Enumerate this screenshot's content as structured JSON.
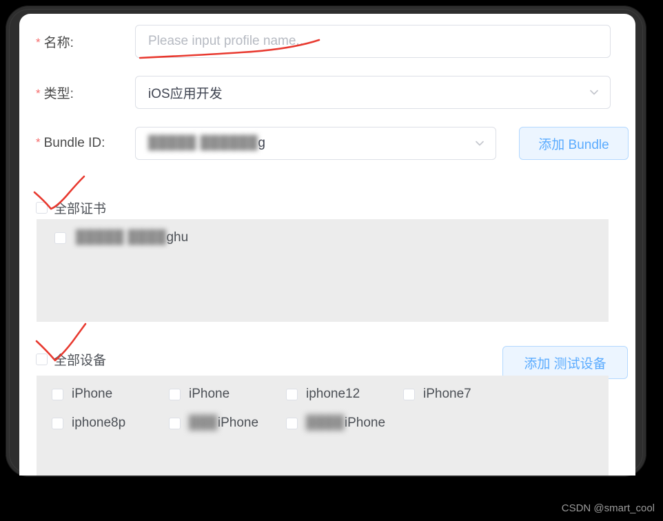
{
  "form": {
    "fields": [
      {
        "label": "名称:",
        "required": true,
        "control_type": "text-input",
        "value": "",
        "placeholder": "Please input profile name..."
      },
      {
        "label": "类型:",
        "required": true,
        "control_type": "select",
        "value": "iOS应用开发",
        "placeholder": ""
      },
      {
        "label": "Bundle ID:",
        "required": true,
        "control_type": "select",
        "value": "",
        "value_redacted": "█████ ██████",
        "value_suffix": "g",
        "placeholder": ""
      }
    ],
    "add_bundle_button": "添加 Bundle"
  },
  "certificates": {
    "select_all_label": "全部证书",
    "select_all_checked": false,
    "items": [
      {
        "redacted": "█████ ████",
        "suffix": "ghu",
        "checked": false
      }
    ]
  },
  "devices": {
    "select_all_label": "全部设备",
    "select_all_checked": false,
    "add_device_button": "添加 测试设备",
    "items": [
      {
        "name": "iPhone",
        "redacted": "",
        "checked": false
      },
      {
        "name": "iPhone",
        "redacted": "",
        "checked": false
      },
      {
        "name": "iphone12",
        "redacted": "",
        "checked": false
      },
      {
        "name": "iPhone7",
        "redacted": "",
        "checked": false
      },
      {
        "name": "iphone8p",
        "redacted": "",
        "checked": false
      },
      {
        "name": "iPhone",
        "redacted": "███",
        "checked": false
      },
      {
        "name": "iPhone",
        "redacted": "████",
        "checked": false
      }
    ]
  },
  "annotations": {
    "name_underline": "red-underline-stroke",
    "certs_check": "red-check-stroke",
    "devices_check": "red-check-stroke",
    "color": "#e8392f"
  },
  "watermark": "CSDN @smart_cool"
}
